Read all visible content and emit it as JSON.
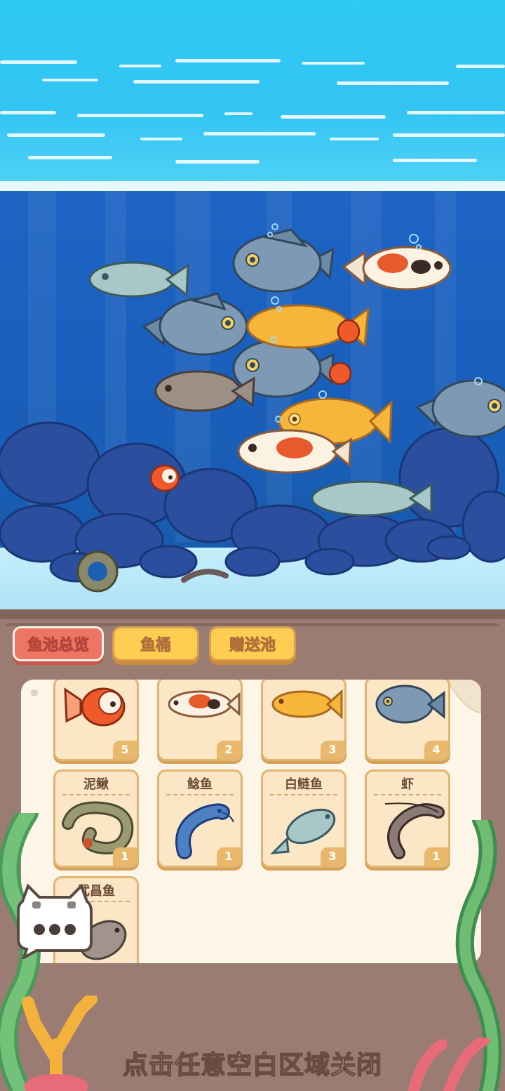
{
  "tabs": [
    {
      "label": "鱼池总览",
      "active": true
    },
    {
      "label": "鱼桶",
      "active": false
    },
    {
      "label": "赠送池",
      "active": false
    }
  ],
  "fish_list": [
    {
      "name": "",
      "count": "5",
      "icon": "goldfish-icon"
    },
    {
      "name": "",
      "count": "2",
      "icon": "koi-icon"
    },
    {
      "name": "",
      "count": "3",
      "icon": "golden-carp-icon"
    },
    {
      "name": "",
      "count": "4",
      "icon": "crucian-carp-icon"
    },
    {
      "name": "泥鳅",
      "count": "1",
      "icon": "loach-icon"
    },
    {
      "name": "鲶鱼",
      "count": "1",
      "icon": "catfish-icon"
    },
    {
      "name": "白鲢鱼",
      "count": "3",
      "icon": "silver-carp-icon"
    },
    {
      "name": "虾",
      "count": "1",
      "icon": "shrimp-icon"
    },
    {
      "name": "武昌鱼",
      "count": "",
      "icon": "bream-icon"
    }
  ],
  "close_hint": "点击任意空白区域关闭",
  "colors": {
    "tab_active": "#ee7563",
    "tab_inactive": "#ffcd52",
    "panel_bg": "#9a7c72",
    "card_bg": "#fbe7c5",
    "water_top": "#2ec9f5",
    "water_deep": "#1d64c4"
  }
}
